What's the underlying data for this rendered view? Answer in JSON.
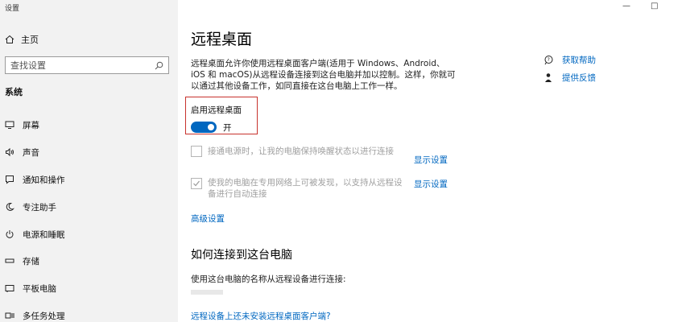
{
  "window": {
    "title": "设置",
    "minimize": "—",
    "maximize": "□"
  },
  "sidebar": {
    "home_label": "主页",
    "search_placeholder": "查找设置",
    "section": "系统",
    "items": [
      {
        "label": "屏幕",
        "icon": "monitor-icon"
      },
      {
        "label": "声音",
        "icon": "speaker-icon"
      },
      {
        "label": "通知和操作",
        "icon": "notification-icon"
      },
      {
        "label": "专注助手",
        "icon": "moon-icon"
      },
      {
        "label": "电源和睡眠",
        "icon": "power-icon"
      },
      {
        "label": "存储",
        "icon": "storage-icon"
      },
      {
        "label": "平板电脑",
        "icon": "tablet-icon"
      },
      {
        "label": "多任务处理",
        "icon": "multitask-icon"
      }
    ]
  },
  "main": {
    "title": "远程桌面",
    "description": "远程桌面允许你使用远程桌面客户端(适用于 Windows、Android、iOS 和 macOS)从远程设备连接到这台电脑并加以控制。这样，你就可以通过其他设备工作，如同直接在这台电脑上工作一样。",
    "toggle_label": "启用远程桌面",
    "toggle_state": "开",
    "toggle_on": true,
    "options": [
      {
        "label": "接通电源时，让我的电脑保持唤醒状态以进行连接",
        "checked": false,
        "link": "显示设置"
      },
      {
        "label": "使我的电脑在专用网络上可被发现，以支持从远程设备进行自动连接",
        "checked": true,
        "link": "显示设置"
      }
    ],
    "advanced_link": "高级设置",
    "connect_title": "如何连接到这台电脑",
    "connect_desc": "使用这台电脑的名称从远程设备进行连接:",
    "no_client_link": "远程设备上还未安装远程桌面客户端?"
  },
  "aside": {
    "help_label": "获取帮助",
    "feedback_label": "提供反馈"
  },
  "colors": {
    "accent": "#0067c0",
    "highlight": "#c8322d",
    "sidebar_bg": "#f2f2f2"
  }
}
